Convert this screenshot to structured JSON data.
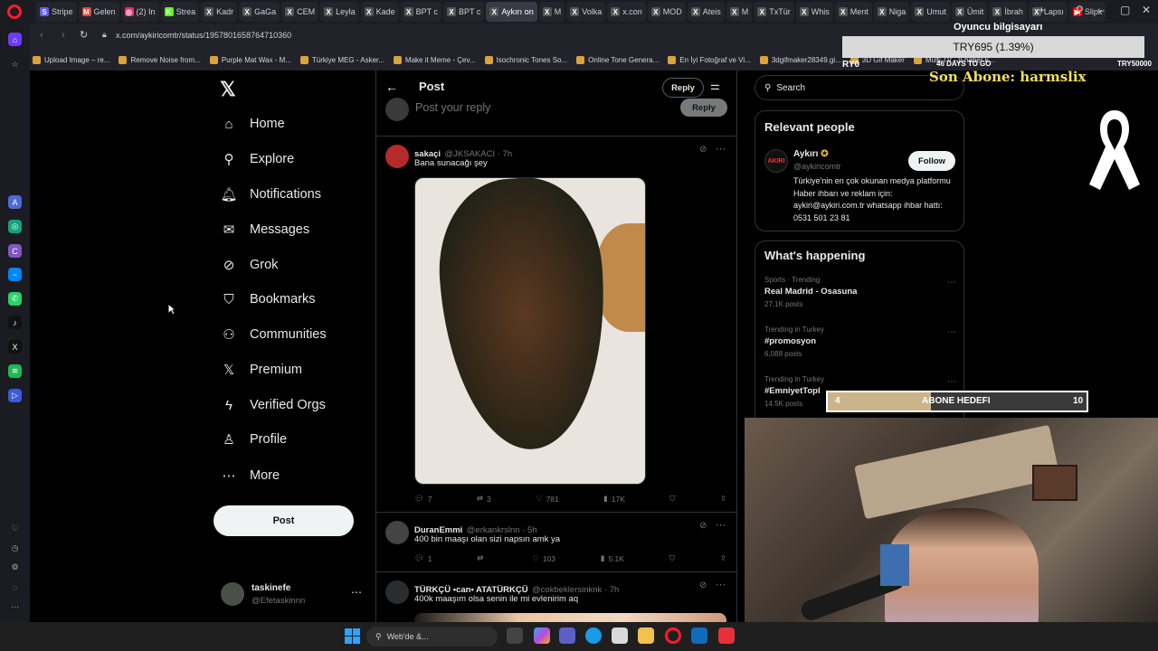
{
  "browser": {
    "tabs": [
      {
        "label": "Stripe",
        "color": "#635bff",
        "glyph": "S"
      },
      {
        "label": "Gelen",
        "color": "#ea4335",
        "glyph": "M"
      },
      {
        "label": "(2) In",
        "color": "#e1306c",
        "glyph": "◎"
      },
      {
        "label": "Strea",
        "color": "#53fc18",
        "glyph": "K"
      },
      {
        "label": "Kadr",
        "color": "#555",
        "glyph": "X"
      },
      {
        "label": "GaGa",
        "color": "#555",
        "glyph": "X"
      },
      {
        "label": "CEM",
        "color": "#555",
        "glyph": "X"
      },
      {
        "label": "Leyla",
        "color": "#555",
        "glyph": "X"
      },
      {
        "label": "Kade",
        "color": "#555",
        "glyph": "X"
      },
      {
        "label": "BPT c",
        "color": "#555",
        "glyph": "X"
      },
      {
        "label": "BPT c",
        "color": "#555",
        "glyph": "X"
      },
      {
        "label": "Aykırı on",
        "color": "#555",
        "glyph": "X",
        "active": true
      },
      {
        "label": "M",
        "color": "#555",
        "glyph": "X"
      },
      {
        "label": "Volka",
        "color": "#555",
        "glyph": "X"
      },
      {
        "label": "x.con",
        "color": "#555",
        "glyph": "X"
      },
      {
        "label": "MOD",
        "color": "#555",
        "glyph": "X"
      },
      {
        "label": "Ateis",
        "color": "#555",
        "glyph": "X"
      },
      {
        "label": "M",
        "color": "#555",
        "glyph": "X"
      },
      {
        "label": "TxTür",
        "color": "#555",
        "glyph": "X"
      },
      {
        "label": "Whis",
        "color": "#555",
        "glyph": "X"
      },
      {
        "label": "Ment",
        "color": "#555",
        "glyph": "X"
      },
      {
        "label": "Niga",
        "color": "#555",
        "glyph": "X"
      },
      {
        "label": "Umut",
        "color": "#555",
        "glyph": "X"
      },
      {
        "label": "Ümit",
        "color": "#555",
        "glyph": "X"
      },
      {
        "label": "İbrah",
        "color": "#555",
        "glyph": "X"
      },
      {
        "label": "Lapsı",
        "color": "#555",
        "glyph": "X"
      },
      {
        "label": "Slipk",
        "color": "#ff0000",
        "glyph": "▶"
      }
    ],
    "url": "x.com/aykiricomtr/status/1957801658764710360",
    "bookmarks": [
      "Upload Image – re...",
      "Remove Noise from...",
      "Purple Mat Wax - M...",
      "Türkiye MEG - Asker...",
      "Make it Meme - Çev...",
      "Isochronic Tones So...",
      "Online Tone Genera...",
      "En İyi Fotoğraf ve Vi...",
      "3dgifmaker28349.gi...",
      "3D Gif Maker",
      "Multi TV - β haber k..."
    ]
  },
  "nav": {
    "items": [
      {
        "label": "Home",
        "icon": "⌂"
      },
      {
        "label": "Explore",
        "icon": "⚲"
      },
      {
        "label": "Notifications",
        "icon": "🔔︎"
      },
      {
        "label": "Messages",
        "icon": "✉"
      },
      {
        "label": "Grok",
        "icon": "⊘"
      },
      {
        "label": "Bookmarks",
        "icon": "⛉"
      },
      {
        "label": "Communities",
        "icon": "⚇"
      },
      {
        "label": "Premium",
        "icon": "𝕏"
      },
      {
        "label": "Verified Orgs",
        "icon": "ϟ"
      },
      {
        "label": "Profile",
        "icon": "♙"
      },
      {
        "label": "More",
        "icon": "⋯"
      }
    ],
    "post_button": "Post",
    "account_name": "taskinefe",
    "account_handle": "@Efetaskinnn"
  },
  "header": {
    "title": "Post",
    "reply_button": "Reply",
    "reply_placeholder": "Post your reply",
    "reply_submit": "Reply"
  },
  "tweets": [
    {
      "name": "sakaçi",
      "handle": "@JKSAKACI · 7h",
      "text": "Bana sunacağı şey",
      "replies": "7",
      "reposts": "3",
      "likes": "781",
      "views": "17K"
    },
    {
      "name": "DuranEmmi",
      "handle": "@erkankrslnn · 5h",
      "text": "400 bin maaşı olan sizi napsın amk ya",
      "replies": "1",
      "reposts": "",
      "likes": "103",
      "views": "5.1K"
    },
    {
      "name": "TÜRKÇÜ •can• ATATÜRKÇÜ",
      "handle": "@cokbeklersinknk · 7h",
      "text": "400k maaşım olsa senin ile mi evlenirim aq"
    }
  ],
  "search": {
    "placeholder": "Search"
  },
  "relevant": {
    "title": "Relevant people",
    "name": "Aykırı",
    "handle": "@aykiricomtr",
    "follow": "Follow",
    "bio": "Türkiye'nin en çok okunan medya platformu Haber ihbarı ve reklam için: aykiri@aykiri.com.tr whatsapp ihbar hattı: 0531 501 23 81"
  },
  "happening": {
    "title": "What's happening",
    "trends": [
      {
        "meta": "Sports · Trending",
        "name": "Real Madrid - Osasuna",
        "count": "27.1K posts"
      },
      {
        "meta": "Trending in Turkey",
        "name": "#promosyon",
        "count": "6,088 posts"
      },
      {
        "meta": "Trending in Turkey",
        "name": "#EmniyetTopl",
        "count": "14.5K posts"
      }
    ]
  },
  "overlay": {
    "top_title": "Oyuncu bilgisayarı",
    "donation": "TRY695 (1.39%)",
    "left_label": "RY0",
    "days_to_go": "46 DAYS TO GO",
    "goal_amount": "TRY50000",
    "last_sub": "Son Abone: harmslix",
    "sub_goal_label": "ABONE HEDEFI",
    "sub_goal_current": "4",
    "sub_goal_target": "10",
    "sub_goal_progress": 0.4
  },
  "taskbar": {
    "search_placeholder": "Web'de &..."
  }
}
